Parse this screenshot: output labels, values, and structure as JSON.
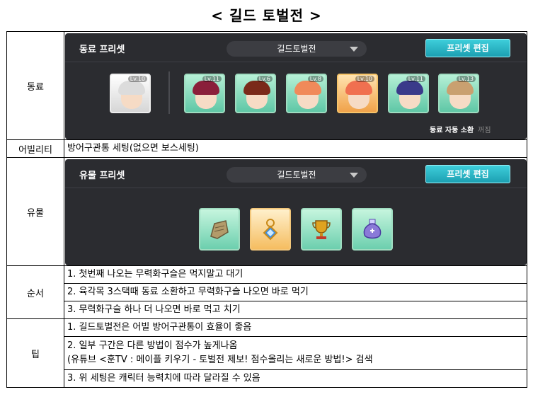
{
  "page_title": "< 길드 토벌전 >",
  "rows": {
    "companion": {
      "header": "동료",
      "panel": {
        "title": "동료 프리셋",
        "dropdown_value": "길드토벌전",
        "edit_button": "프리셋 편집",
        "auto_summon_label": "동료 자동 소환",
        "auto_summon_state": "꺼짐",
        "cards": [
          {
            "level": "Lv.10",
            "style": "white",
            "hair": "#dcdcdc"
          },
          {
            "level": "Lv.11",
            "style": "green",
            "hair": "#8a1f3a"
          },
          {
            "level": "Lv.6",
            "style": "green",
            "hair": "#7a2a1a"
          },
          {
            "level": "Lv.8",
            "style": "green",
            "hair": "#f08a5a"
          },
          {
            "level": "Lv.10",
            "style": "orange",
            "hair": "#f07050"
          },
          {
            "level": "Lv.11",
            "style": "green",
            "hair": "#3a3a8a"
          },
          {
            "level": "Lv.13",
            "style": "green",
            "hair": "#c9a070"
          }
        ]
      }
    },
    "ability": {
      "header": "어빌리티",
      "text": "방어구관통 세팅(없으면 보스세팅)"
    },
    "relic": {
      "header": "유물",
      "panel": {
        "title": "유물 프리셋",
        "dropdown_value": "길드토벌전",
        "edit_button": "프리셋 편집",
        "relics": [
          {
            "icon": "scroll-icon",
            "style": "green",
            "color": "#b39b6a"
          },
          {
            "icon": "amulet-icon",
            "style": "orange",
            "color": "#3f8fe0"
          },
          {
            "icon": "trophy-icon",
            "style": "green",
            "color": "#e0a320"
          },
          {
            "icon": "potion-icon",
            "style": "green",
            "color": "#8a7ad8"
          }
        ]
      }
    },
    "order": {
      "header": "순서",
      "items": [
        "1. 첫번째 나오는 무력화구슬은 먹지말고 대기",
        "2. 육각목 3스택때 동료 소환하고 무력화구슬 나오면 바로 먹기",
        "3. 무력화구슬 하나 더 나오면 바로 먹고 치기"
      ]
    },
    "tips": {
      "header": "팁",
      "items": [
        "1. 길드토벌전은 어빌 방어구관통이 효율이 좋음",
        "2. 일부 구간은 다른 방법이 점수가 높게나옴",
        "(유튜브 <훈TV : 메이플 키우기 - 토벌전 제보! 점수올리는 새로운 방법!> 검색",
        "3. 위 세팅은 캐릭터 능력치에 따라 달라질 수 있음"
      ]
    }
  }
}
